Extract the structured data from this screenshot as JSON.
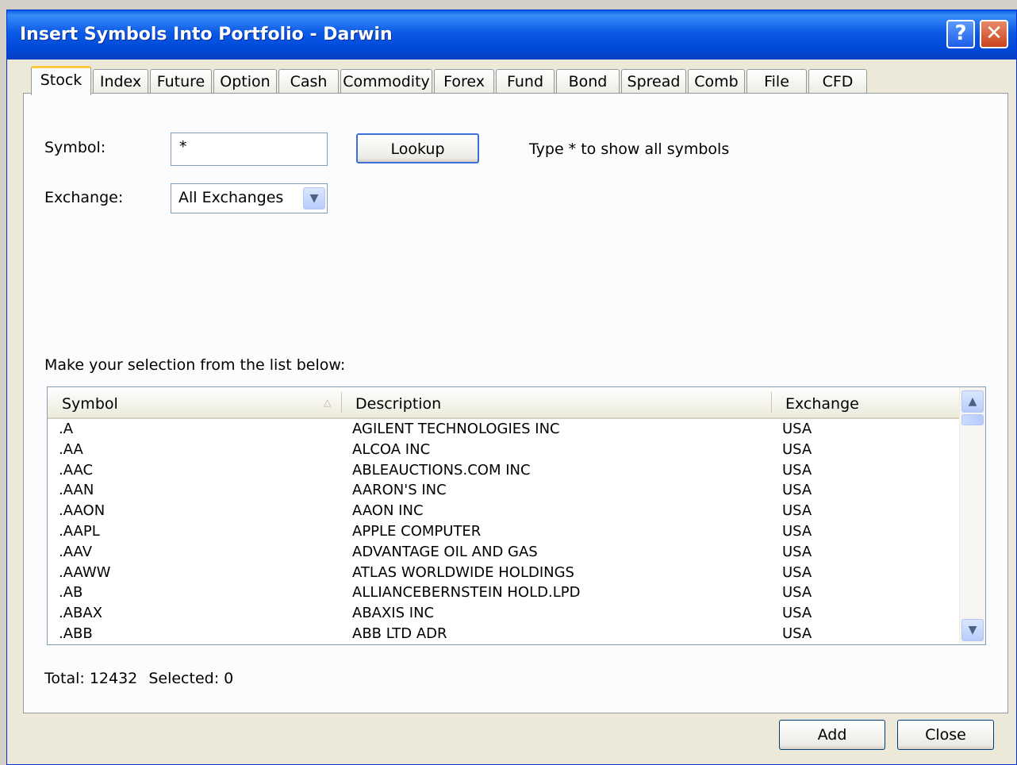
{
  "window": {
    "title": "Insert Symbols Into Portfolio - Darwin",
    "help_label": "?",
    "close_label": "✕"
  },
  "tabs": [
    "Stock",
    "Index",
    "Future",
    "Option",
    "Cash",
    "Commodity",
    "Forex",
    "Fund",
    "Bond",
    "Spread",
    "Comb",
    "File",
    "CFD"
  ],
  "active_tab": "Stock",
  "form": {
    "symbol_label": "Symbol:",
    "symbol_value": "*",
    "lookup_label": "Lookup",
    "hint": "Type * to show all symbols",
    "exchange_label": "Exchange:",
    "exchange_value": "All Exchanges"
  },
  "list_caption": "Make your selection from the list below:",
  "columns": [
    "Symbol",
    "Description",
    "Exchange"
  ],
  "rows": [
    [
      ".A",
      "AGILENT TECHNOLOGIES INC",
      "USA"
    ],
    [
      ".AA",
      "ALCOA INC",
      "USA"
    ],
    [
      ".AAC",
      "ABLEAUCTIONS.COM INC",
      "USA"
    ],
    [
      ".AAN",
      "AARON'S INC",
      "USA"
    ],
    [
      ".AAON",
      "AAON INC",
      "USA"
    ],
    [
      ".AAPL",
      "APPLE COMPUTER",
      "USA"
    ],
    [
      ".AAV",
      "ADVANTAGE OIL AND GAS",
      "USA"
    ],
    [
      ".AAWW",
      "ATLAS WORLDWIDE HOLDINGS",
      "USA"
    ],
    [
      ".AB",
      "ALLIANCEBERNSTEIN HOLD.LPD",
      "USA"
    ],
    [
      ".ABAX",
      "ABAXIS INC",
      "USA"
    ],
    [
      ".ABB",
      "ABB LTD ADR",
      "USA"
    ]
  ],
  "status": {
    "total_label": "Total:",
    "total_value": "12432",
    "selected_label": "Selected:",
    "selected_value": "0"
  },
  "buttons": {
    "add": "Add",
    "close": "Close"
  }
}
